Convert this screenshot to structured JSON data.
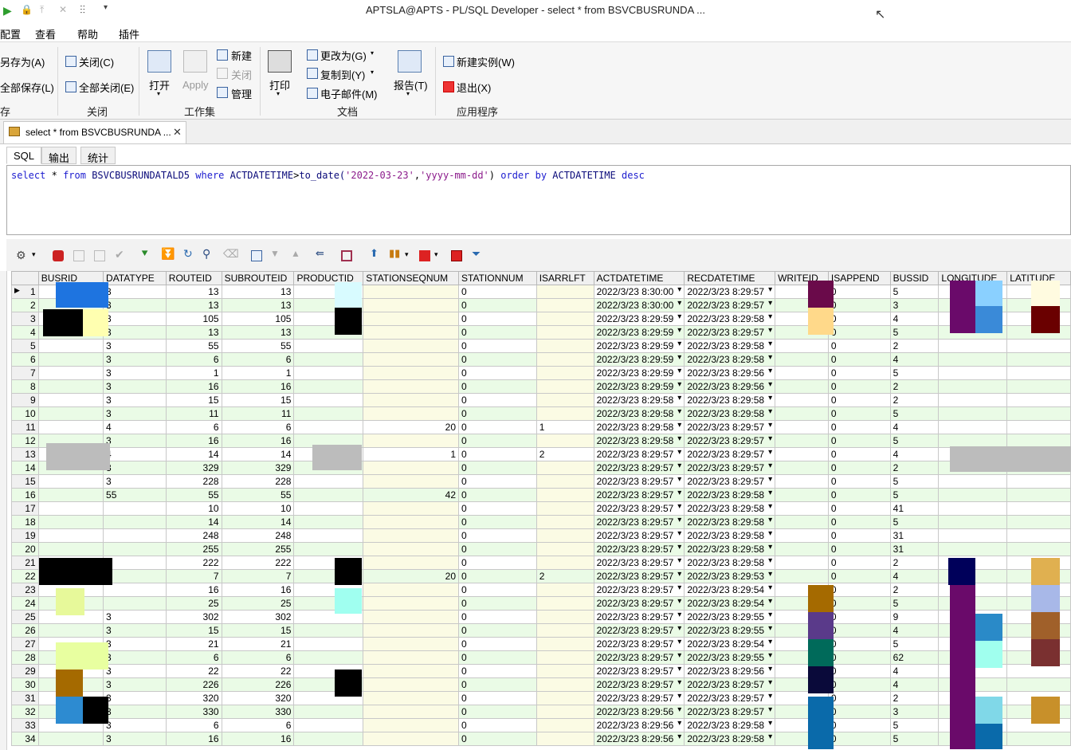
{
  "window": {
    "title": "APTSLA@APTS - PL/SQL Developer - select * from BSVCBUSRUNDA ..."
  },
  "menu": [
    "配置",
    "查看",
    "帮助",
    "插件"
  ],
  "ribbon": {
    "file": {
      "save_as": "另存为(A)",
      "save_all": "全部保存(L)",
      "group": "存"
    },
    "close": {
      "close": "关闭(C)",
      "close_all": "全部关闭(E)",
      "group": "关闭"
    },
    "workset": {
      "open": "打开",
      "apply": "Apply",
      "new": "新建",
      "close": "关闭",
      "manage": "管理",
      "group": "工作集"
    },
    "document": {
      "print": "打印",
      "change_to": "更改为(G)",
      "copy_to": "复制到(Y)",
      "email": "电子邮件(M)",
      "report": "报告(T)",
      "group": "文档"
    },
    "app": {
      "new_instance": "新建实例(W)",
      "exit": "退出(X)",
      "group": "应用程序"
    }
  },
  "document_tab": {
    "label": "select * from BSVCBUSRUNDA ...",
    "close": "✕"
  },
  "subtabs": [
    "SQL",
    "输出",
    "统计"
  ],
  "sql": {
    "select": "select",
    "star": "*",
    "from": "from",
    "table": "BSVCBUSRUNDATALD5",
    "where": "where",
    "col": "ACTDATETIME",
    "gt": ">",
    "fn": "to_date(",
    "date": "'2022-03-23'",
    "comma": ",",
    "fmt": "'yyyy-mm-dd'",
    "close": ")",
    "order": "order by",
    "ordercol": "ACTDATETIME",
    "desc": "desc"
  },
  "grid": {
    "columns": [
      "",
      "BUSRID",
      "DATATYPE",
      "ROUTEID",
      "SUBROUTEID",
      "PRODUCTID",
      "STATIONSEQNUM",
      "STATIONNUM",
      "ISARRLFT",
      "ACTDATETIME",
      "RECDATETIME",
      "WRITEID",
      "ISAPPEND",
      "BUSSID",
      "LONGITUDE",
      "LATITUDE"
    ],
    "rows": [
      [
        "1",
        "",
        "3",
        "13",
        "13",
        "",
        "",
        "0",
        "",
        "2022/3/23 8:30:00",
        "2022/3/23 8:29:57",
        "",
        "0",
        "5",
        "",
        ""
      ],
      [
        "2",
        "",
        "3",
        "13",
        "13",
        "",
        "",
        "0",
        "",
        "2022/3/23 8:30:00",
        "2022/3/23 8:29:57",
        "",
        "0",
        "3",
        "",
        ""
      ],
      [
        "3",
        "",
        "3",
        "105",
        "105",
        "",
        "",
        "0",
        "",
        "2022/3/23 8:29:59",
        "2022/3/23 8:29:58",
        "",
        "0",
        "4",
        "",
        ""
      ],
      [
        "4",
        "",
        "3",
        "13",
        "13",
        "",
        "",
        "0",
        "",
        "2022/3/23 8:29:59",
        "2022/3/23 8:29:57",
        "",
        "0",
        "5",
        "",
        ""
      ],
      [
        "5",
        "",
        "3",
        "55",
        "55",
        "",
        "",
        "0",
        "",
        "2022/3/23 8:29:59",
        "2022/3/23 8:29:58",
        "",
        "0",
        "2",
        "",
        ""
      ],
      [
        "6",
        "",
        "3",
        "6",
        "6",
        "",
        "",
        "0",
        "",
        "2022/3/23 8:29:59",
        "2022/3/23 8:29:58",
        "",
        "0",
        "4",
        "",
        ""
      ],
      [
        "7",
        "",
        "3",
        "1",
        "1",
        "",
        "",
        "0",
        "",
        "2022/3/23 8:29:59",
        "2022/3/23 8:29:56",
        "",
        "0",
        "5",
        "",
        ""
      ],
      [
        "8",
        "",
        "3",
        "16",
        "16",
        "",
        "",
        "0",
        "",
        "2022/3/23 8:29:59",
        "2022/3/23 8:29:56",
        "",
        "0",
        "2",
        "",
        ""
      ],
      [
        "9",
        "",
        "3",
        "15",
        "15",
        "",
        "",
        "0",
        "",
        "2022/3/23 8:29:58",
        "2022/3/23 8:29:58",
        "",
        "0",
        "2",
        "",
        ""
      ],
      [
        "10",
        "",
        "3",
        "11",
        "11",
        "",
        "",
        "0",
        "",
        "2022/3/23 8:29:58",
        "2022/3/23 8:29:58",
        "",
        "0",
        "5",
        "",
        ""
      ],
      [
        "11",
        "",
        "4",
        "6",
        "6",
        "",
        "20",
        "0",
        "1",
        "2022/3/23 8:29:58",
        "2022/3/23 8:29:57",
        "",
        "0",
        "4",
        "",
        ""
      ],
      [
        "12",
        "",
        "3",
        "16",
        "16",
        "",
        "",
        "0",
        "",
        "2022/3/23 8:29:58",
        "2022/3/23 8:29:57",
        "",
        "0",
        "5",
        "",
        ""
      ],
      [
        "13",
        "",
        "4",
        "14",
        "14",
        "",
        "1",
        "0",
        "2",
        "2022/3/23 8:29:57",
        "2022/3/23 8:29:57",
        "",
        "0",
        "4",
        "",
        ""
      ],
      [
        "14",
        "",
        "3",
        "329",
        "329",
        "",
        "",
        "0",
        "",
        "2022/3/23 8:29:57",
        "2022/3/23 8:29:57",
        "",
        "0",
        "2",
        "",
        ""
      ],
      [
        "15",
        "",
        "3",
        "228",
        "228",
        "",
        "",
        "0",
        "",
        "2022/3/23 8:29:57",
        "2022/3/23 8:29:57",
        "",
        "0",
        "5",
        "",
        ""
      ],
      [
        "16",
        "",
        "55",
        "55",
        "55",
        "",
        "42",
        "0",
        "",
        "2022/3/23 8:29:57",
        "2022/3/23 8:29:58",
        "",
        "0",
        "5",
        "",
        ""
      ],
      [
        "17",
        "",
        "",
        "10",
        "10",
        "",
        "",
        "0",
        "",
        "2022/3/23 8:29:57",
        "2022/3/23 8:29:58",
        "",
        "0",
        "41",
        "",
        ""
      ],
      [
        "18",
        "",
        "",
        "14",
        "14",
        "",
        "",
        "0",
        "",
        "2022/3/23 8:29:57",
        "2022/3/23 8:29:58",
        "",
        "0",
        "5",
        "",
        ""
      ],
      [
        "19",
        "",
        "",
        "248",
        "248",
        "",
        "",
        "0",
        "",
        "2022/3/23 8:29:57",
        "2022/3/23 8:29:58",
        "",
        "0",
        "31",
        "",
        ""
      ],
      [
        "20",
        "",
        "",
        "255",
        "255",
        "",
        "",
        "0",
        "",
        "2022/3/23 8:29:57",
        "2022/3/23 8:29:58",
        "",
        "0",
        "31",
        "",
        ""
      ],
      [
        "21",
        "",
        "",
        "222",
        "222",
        "",
        "",
        "0",
        "",
        "2022/3/23 8:29:57",
        "2022/3/23 8:29:58",
        "",
        "0",
        "2",
        "",
        ""
      ],
      [
        "22",
        "",
        "",
        "7",
        "7",
        "",
        "20",
        "0",
        "2",
        "2022/3/23 8:29:57",
        "2022/3/23 8:29:53",
        "",
        "0",
        "4",
        "",
        ""
      ],
      [
        "23",
        "",
        "",
        "16",
        "16",
        "",
        "",
        "0",
        "",
        "2022/3/23 8:29:57",
        "2022/3/23 8:29:54",
        "",
        "0",
        "2",
        "",
        ""
      ],
      [
        "24",
        "",
        "",
        "25",
        "25",
        "",
        "",
        "0",
        "",
        "2022/3/23 8:29:57",
        "2022/3/23 8:29:54",
        "",
        "0",
        "5",
        "",
        ""
      ],
      [
        "25",
        "",
        "3",
        "302",
        "302",
        "",
        "",
        "0",
        "",
        "2022/3/23 8:29:57",
        "2022/3/23 8:29:55",
        "",
        "0",
        "9",
        "",
        ""
      ],
      [
        "26",
        "",
        "3",
        "15",
        "15",
        "",
        "",
        "0",
        "",
        "2022/3/23 8:29:57",
        "2022/3/23 8:29:55",
        "",
        "0",
        "4",
        "",
        ""
      ],
      [
        "27",
        "",
        "3",
        "21",
        "21",
        "",
        "",
        "0",
        "",
        "2022/3/23 8:29:57",
        "2022/3/23 8:29:54",
        "",
        "0",
        "5",
        "",
        ""
      ],
      [
        "28",
        "",
        "3",
        "6",
        "6",
        "",
        "",
        "0",
        "",
        "2022/3/23 8:29:57",
        "2022/3/23 8:29:55",
        "",
        "0",
        "62",
        "",
        ""
      ],
      [
        "29",
        "",
        "3",
        "22",
        "22",
        "",
        "",
        "0",
        "",
        "2022/3/23 8:29:57",
        "2022/3/23 8:29:56",
        "",
        "0",
        "4",
        "",
        ""
      ],
      [
        "30",
        "",
        "3",
        "226",
        "226",
        "",
        "",
        "0",
        "",
        "2022/3/23 8:29:57",
        "2022/3/23 8:29:57",
        "",
        "0",
        "4",
        "",
        ""
      ],
      [
        "31",
        "",
        "3",
        "320",
        "320",
        "",
        "",
        "0",
        "",
        "2022/3/23 8:29:57",
        "2022/3/23 8:29:57",
        "",
        "0",
        "2",
        "",
        ""
      ],
      [
        "32",
        "",
        "3",
        "330",
        "330",
        "",
        "",
        "0",
        "",
        "2022/3/23 8:29:56",
        "2022/3/23 8:29:57",
        "",
        "0",
        "3",
        "",
        ""
      ],
      [
        "33",
        "",
        "3",
        "6",
        "6",
        "",
        "",
        "0",
        "",
        "2022/3/23 8:29:56",
        "2022/3/23 8:29:58",
        "",
        "0",
        "5",
        "",
        ""
      ],
      [
        "34",
        "",
        "3",
        "16",
        "16",
        "",
        "",
        "0",
        "",
        "2022/3/23 8:29:56",
        "2022/3/23 8:29:58",
        "",
        "0",
        "5",
        "",
        ""
      ]
    ]
  }
}
